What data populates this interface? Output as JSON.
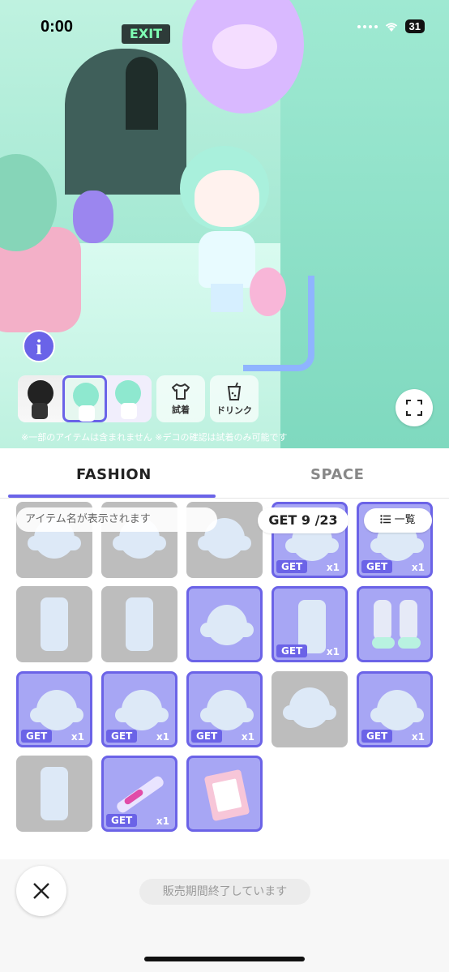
{
  "status_bar": {
    "time": "0:00",
    "battery": "31"
  },
  "scene": {
    "exit_sign": "EXIT"
  },
  "actions": {
    "try_on": "試着",
    "drink": "ドリンク"
  },
  "notice": "※一部のアイテムは含まれません ※デコの確認は試着のみ可能です",
  "tabs": {
    "fashion": "FASHION",
    "space": "SPACE"
  },
  "item_name_placeholder": "アイテム名が表示されます",
  "get_count": "GET 9 /23",
  "list_button": "一覧",
  "items": [
    {
      "owned": false,
      "kind": "head"
    },
    {
      "owned": false,
      "kind": "head"
    },
    {
      "owned": false,
      "kind": "head"
    },
    {
      "owned": true,
      "kind": "head",
      "get": "GET",
      "qty": "x1"
    },
    {
      "owned": true,
      "kind": "head",
      "get": "GET",
      "qty": "x1"
    },
    {
      "owned": false,
      "kind": "cloth"
    },
    {
      "owned": false,
      "kind": "cloth"
    },
    {
      "owned": true,
      "kind": "head"
    },
    {
      "owned": true,
      "kind": "cloth",
      "get": "GET",
      "qty": "x1"
    },
    {
      "owned": true,
      "kind": "shoes"
    },
    {
      "owned": true,
      "kind": "head",
      "get": "GET",
      "qty": "x1"
    },
    {
      "owned": true,
      "kind": "head",
      "get": "GET",
      "qty": "x1"
    },
    {
      "owned": true,
      "kind": "head",
      "get": "GET",
      "qty": "x1"
    },
    {
      "owned": false,
      "kind": "head"
    },
    {
      "owned": true,
      "kind": "head",
      "get": "GET",
      "qty": "x1"
    },
    {
      "owned": false,
      "kind": "cloth"
    },
    {
      "owned": true,
      "kind": "syringe",
      "get": "GET",
      "qty": "x1"
    },
    {
      "owned": true,
      "kind": "card"
    }
  ],
  "sale_status": "販売期間終了しています",
  "colors": {
    "accent": "#6b63e7",
    "owned_bg": "#a7a6f4",
    "unowned_bg": "#bdbdbd"
  }
}
